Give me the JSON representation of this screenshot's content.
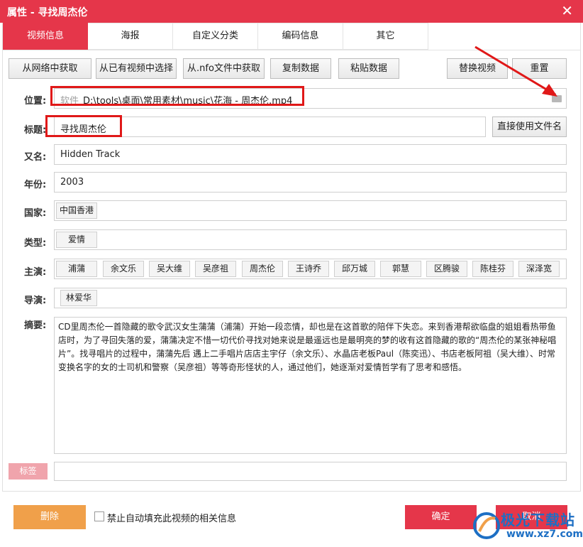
{
  "window": {
    "title": "属性 - 寻找周杰伦",
    "close_glyph": "✕"
  },
  "tabs": [
    "视频信息",
    "海报",
    "自定义分类",
    "编码信息",
    "其它"
  ],
  "toolbar": {
    "fetch_network": "从网络中获取",
    "select_existing": "从已有视频中选择",
    "fetch_nfo": "从.nfo文件中获取",
    "copy_data": "复制数据",
    "paste_data": "粘贴数据",
    "replace_video": "替换视频",
    "reset": "重置"
  },
  "fields": {
    "location_label": "位置:",
    "location_prefix": "软件",
    "location_path": "D:\\tools\\桌面\\常用素材\\music\\花海 - 周杰伦.mp4",
    "title_label": "标题:",
    "title_value": "寻找周杰伦",
    "use_filename": "直接使用文件名",
    "alias_label": "又名:",
    "alias_value": "Hidden Track",
    "year_label": "年份:",
    "year_value": "2003",
    "country_label": "国家:",
    "country_chip": "中国香港",
    "genre_label": "类型:",
    "genre_chip": "爱情",
    "cast_label": "主演:",
    "cast": [
      "浦蒲",
      "余文乐",
      "吴大维",
      "吴彦祖",
      "周杰伦",
      "王诗乔",
      "邱万城",
      "郭慧",
      "区腾骏",
      "陈桂芬",
      "深泽宽"
    ],
    "director_label": "导演:",
    "director_chip": "林爱华",
    "summary_label": "摘要:",
    "summary_text": "CD里周杰伦一首隐藏的歌令武汉女生蒲蒲（浦蒲）开始一段恋情，却也是在这首歌的陪伴下失恋。来到香港帮欲临盘的姐姐看热带鱼店时，为了寻回失落的爱，蒲蒲决定不惜一切代价寻找对她来说是最遥远也是最明亮的梦的收有这首隐藏的歌的“周杰伦的某张神秘唱片”。找寻唱片的过程中，蒲蒲先后 遇上二手唱片店店主宇仔（余文乐）、水晶店老板Paul（陈奕迅）、书店老板阿祖（吴大维）、时常变换名字的女的士司机和警察（吴彦祖）等等奇形怪状的人，通过他们，她逐渐对爱情哲学有了思考和感悟。",
    "tag_button": "标签",
    "tag_value": ""
  },
  "bottom": {
    "delete": "删除",
    "checkbox_label": "禁止自动填充此视频的相关信息",
    "ok": "确定",
    "cancel": "取消"
  },
  "watermark": {
    "line1": "极光下载站",
    "line2": "www.xz7.com"
  },
  "colors": {
    "accent": "#e5364a",
    "annotation": "#e01818",
    "delete": "#f0a04a",
    "watermark": "#1d6fc4"
  }
}
